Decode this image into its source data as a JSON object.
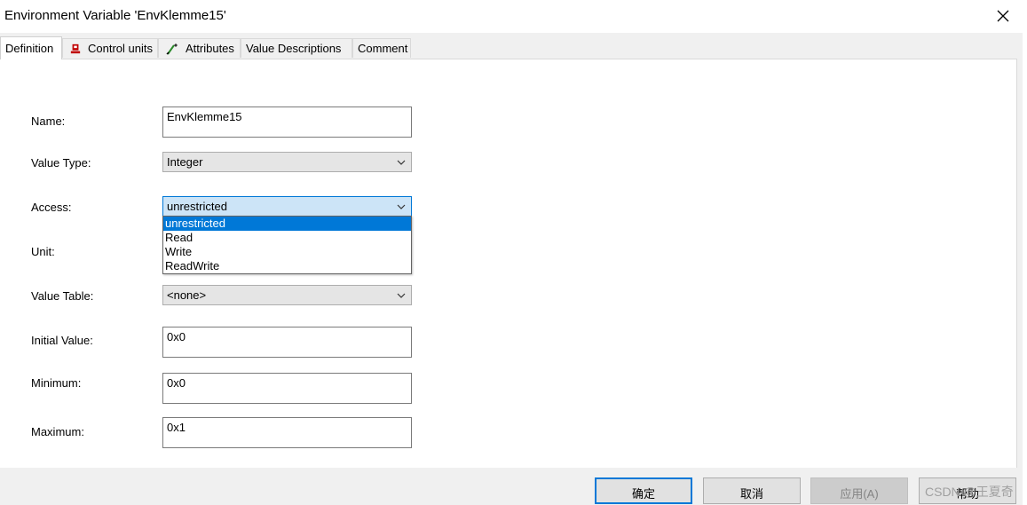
{
  "window": {
    "title": "Environment Variable 'EnvKlemme15'",
    "close_icon": "close-icon"
  },
  "tabs": [
    {
      "label": "Definition",
      "icon": ""
    },
    {
      "label": "Control units",
      "icon": "control-units-icon"
    },
    {
      "label": "Attributes",
      "icon": "attributes-icon"
    },
    {
      "label": "Value Descriptions",
      "icon": ""
    },
    {
      "label": "Comment",
      "icon": ""
    }
  ],
  "form": {
    "name": {
      "label": "Name:",
      "value": "EnvKlemme15"
    },
    "value_type": {
      "label": "Value Type:",
      "value": "Integer"
    },
    "access": {
      "label": "Access:",
      "value": "unrestricted",
      "options": [
        "unrestricted",
        "Read",
        "Write",
        "ReadWrite"
      ],
      "selected_index": 0,
      "open": true
    },
    "unit": {
      "label": "Unit:"
    },
    "value_table": {
      "label": "Value Table:",
      "value": "<none>"
    },
    "initial_value": {
      "label": "Initial Value:",
      "value": "0x0"
    },
    "minimum": {
      "label": "Minimum:",
      "value": "0x0"
    },
    "maximum": {
      "label": "Maximum:",
      "value": "0x1"
    }
  },
  "buttons": {
    "ok": "确定",
    "cancel": "取消",
    "apply": "应用(A)",
    "help": "帮助"
  },
  "watermark": "CSDN @王夏奇",
  "colors": {
    "selection": "#0078d7",
    "focus_fill": "#cce4f7",
    "window_bg": "#f0f0f0"
  }
}
